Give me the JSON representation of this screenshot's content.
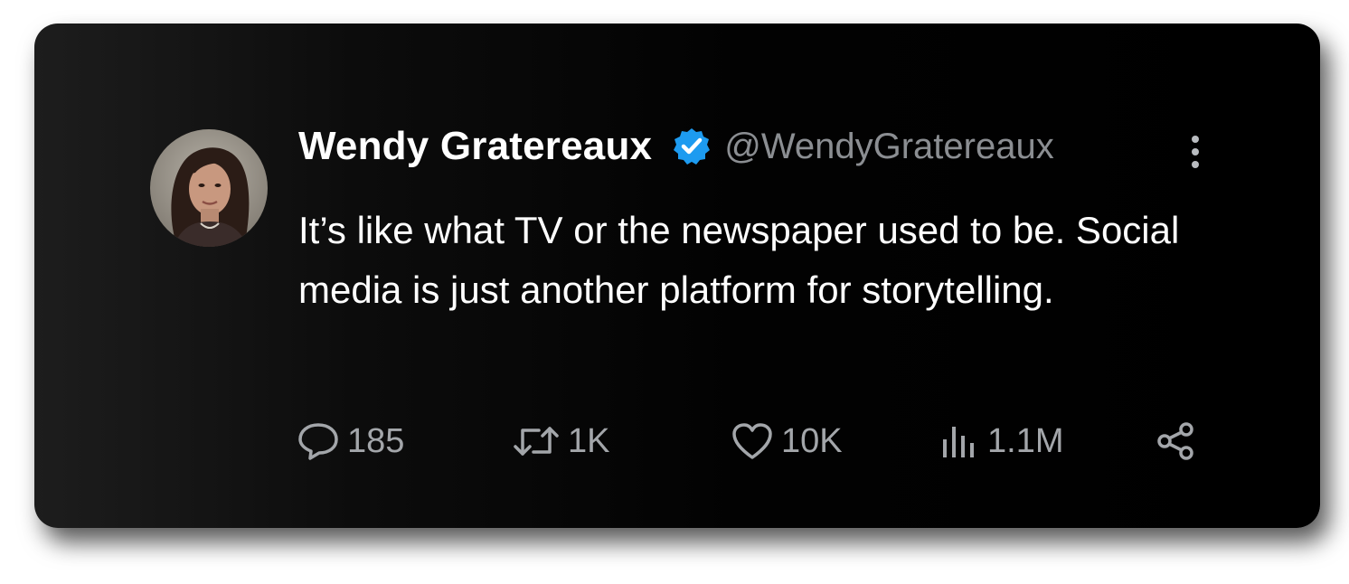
{
  "tweet": {
    "author_name": "Wendy Gratereaux",
    "handle": "@WendyGratereaux",
    "text": "It’s like what TV or the newspaper used to be. Social media is just another platform for storytelling.",
    "verified": true
  },
  "actions": {
    "replies": "185",
    "retweets": "1K",
    "likes": "10K",
    "views": "1.1M"
  },
  "icons": {
    "avatar": "avatar-photo",
    "verified": "verified-badge-icon",
    "more": "more-options-icon",
    "reply": "reply-icon",
    "retweet": "retweet-icon",
    "like": "like-icon",
    "views": "views-icon",
    "share": "share-icon"
  },
  "colors": {
    "card_background": "#000000",
    "name_text": "#ffffff",
    "handle_text": "#8b8e92",
    "action_text": "#a3a6aa",
    "verified_badge": "#1d9bf0"
  }
}
